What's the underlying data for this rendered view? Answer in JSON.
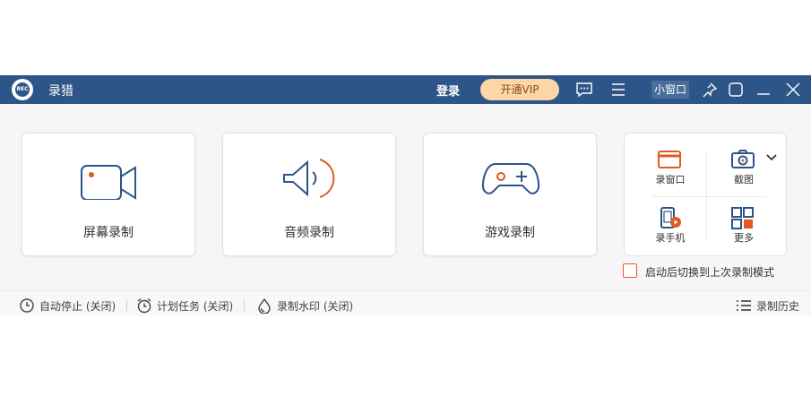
{
  "titlebar": {
    "app_name": "录猎",
    "login_label": "登录",
    "vip_label": "开通VIP",
    "mini_window_label": "小窗口",
    "icons": [
      "message-icon",
      "menu-icon",
      "pin-icon",
      "restore-icon",
      "minimize-icon",
      "close-icon"
    ]
  },
  "cards": [
    {
      "label": "屏幕录制",
      "icon": "camera-icon"
    },
    {
      "label": "音频录制",
      "icon": "speaker-icon"
    },
    {
      "label": "游戏录制",
      "icon": "gamepad-icon"
    }
  ],
  "tools": [
    {
      "label": "录窗口",
      "icon": "window-icon"
    },
    {
      "label": "截图",
      "icon": "screenshot-icon"
    },
    {
      "label": "录手机",
      "icon": "phone-icon"
    },
    {
      "label": "更多",
      "icon": "grid-icon"
    }
  ],
  "start_mode": {
    "label": "启动后切换到上次录制模式",
    "checked": false
  },
  "bottom": {
    "auto_stop": "自动停止 (关闭)",
    "scheduled_task": "计划任务 (关闭)",
    "watermark": "录制水印 (关闭)",
    "history": "录制历史"
  },
  "colors": {
    "titlebar": "#2d5587",
    "accent": "#e15a23",
    "icon_blue": "#2d5587",
    "vip_bg": "#fbd6a6"
  }
}
